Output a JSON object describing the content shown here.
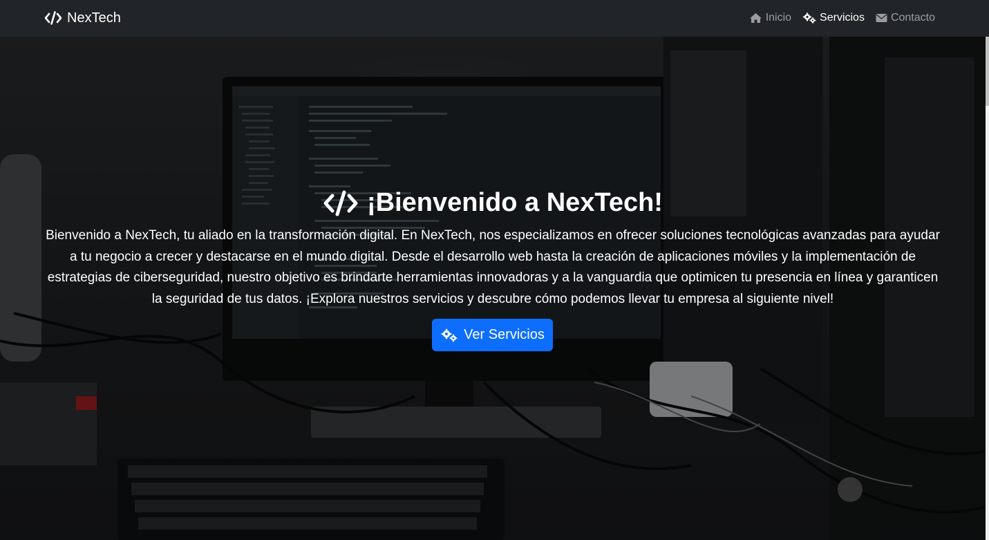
{
  "brand": {
    "name": "NexTech",
    "icon": "code-icon"
  },
  "nav": {
    "items": [
      {
        "label": "Inicio",
        "icon": "home-icon",
        "active": false
      },
      {
        "label": "Servicios",
        "icon": "gears-icon",
        "active": true
      },
      {
        "label": "Contacto",
        "icon": "envelope-icon",
        "active": false
      }
    ]
  },
  "hero": {
    "title": "¡Bienvenido a NexTech!",
    "title_icon": "code-icon",
    "text": "Bienvenido a NexTech, tu aliado en la transformación digital. En NexTech, nos especializamos en ofrecer soluciones tecnológicas avanzadas para ayudar a tu negocio a crecer y destacarse en el mundo digital. Desde el desarrollo web hasta la creación de aplicaciones móviles y la implementación de estrategias de ciberseguridad, nuestro objetivo es brindarte herramientas innovadoras y a la vanguardia que optimicen tu presencia en línea y garanticen la seguridad de tus datos. ¡Explora nuestros servicios y descubre cómo podemos llevar tu empresa al siguiente nivel!",
    "cta_label": "Ver Servicios",
    "cta_icon": "gears-icon"
  },
  "colors": {
    "navbar_bg": "#212529",
    "primary": "#0d6efd",
    "nav_inactive": "rgba(255,255,255,0.55)",
    "nav_active": "#ffffff"
  }
}
